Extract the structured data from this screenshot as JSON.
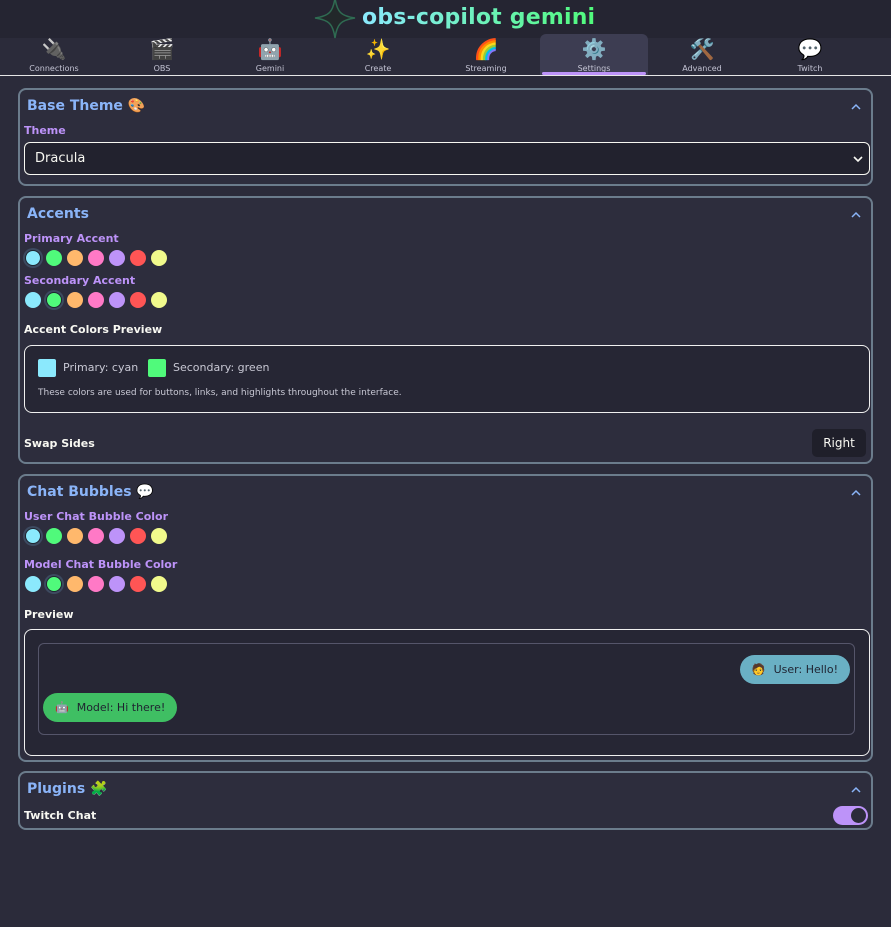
{
  "app": {
    "title": "obs-copilot gemini"
  },
  "tabs": [
    {
      "icon": "🔌",
      "label": "Connections"
    },
    {
      "icon": "🎬",
      "label": "OBS"
    },
    {
      "icon": "🤖",
      "label": "Gemini"
    },
    {
      "icon": "✨",
      "label": "Create"
    },
    {
      "icon": "🌈",
      "label": "Streaming"
    },
    {
      "icon": "⚙️",
      "label": "Settings",
      "active": true
    },
    {
      "icon": "🛠️",
      "label": "Advanced"
    },
    {
      "icon": "💬",
      "label": "Twitch"
    }
  ],
  "colors": {
    "cyan": "#8be9fd",
    "green": "#50fa7b",
    "orange": "#ffb86c",
    "pink": "#ff79c6",
    "purple": "#bd93f9",
    "red": "#ff5555",
    "yellow": "#f1fa8c"
  },
  "base_theme": {
    "title": "Base Theme 🎨",
    "theme_label": "Theme",
    "theme_value": "Dracula"
  },
  "accents": {
    "title": "Accents",
    "primary_label": "Primary Accent",
    "secondary_label": "Secondary Accent",
    "primary_selected": "cyan",
    "secondary_selected": "green",
    "preview_heading": "Accent Colors Preview",
    "primary_text": "Primary: cyan",
    "secondary_text": "Secondary: green",
    "note": "These colors are used for buttons, links, and highlights throughout the interface.",
    "swap_label": "Swap Sides",
    "swap_value": "Right"
  },
  "chat_bubbles": {
    "title": "Chat Bubbles 💬",
    "user_label": "User Chat Bubble Color",
    "model_label": "Model Chat Bubble Color",
    "user_selected": "cyan",
    "model_selected": "green",
    "preview_heading": "Preview",
    "user_bubble": {
      "emoji": "🧑",
      "text": "User: Hello!"
    },
    "model_bubble": {
      "emoji": "🤖",
      "text": "Model: Hi there!"
    }
  },
  "plugins": {
    "title": "Plugins 🧩",
    "twitch_chat_label": "Twitch Chat",
    "twitch_chat_enabled": true
  }
}
